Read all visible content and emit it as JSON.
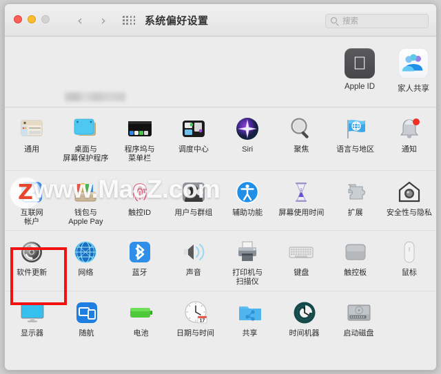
{
  "window": {
    "title": "系统偏好设置",
    "traffic_lights": [
      "close",
      "minimize",
      "zoom"
    ],
    "nav": {
      "back": "‹",
      "forward": "›"
    },
    "grid_icon": "grid-icon"
  },
  "search": {
    "placeholder": "搜索",
    "value": "",
    "icon": "search-icon"
  },
  "account": {
    "name": "",
    "subtitle": "Apple ID、iCloud",
    "avatar": "user-avatar",
    "tiles": [
      {
        "label": "Apple ID",
        "icon": "apple-logo-icon"
      },
      {
        "label": "家人共享",
        "icon": "family-sharing-icon"
      }
    ]
  },
  "watermark": {
    "text": "www.MacZ.com",
    "badge": "Z"
  },
  "highlight": {
    "target": "软件更新",
    "color": "#f21212"
  },
  "panes": {
    "rows": [
      [
        {
          "label": "通用",
          "icon": "general-icon"
        },
        {
          "label": "桌面与\n屏幕保护程序",
          "icon": "desktop-screensaver-icon"
        },
        {
          "label": "程序坞与\n菜单栏",
          "icon": "dock-menubar-icon"
        },
        {
          "label": "调度中心",
          "icon": "mission-control-icon"
        },
        {
          "label": "Siri",
          "icon": "siri-icon"
        },
        {
          "label": "聚焦",
          "icon": "spotlight-icon"
        },
        {
          "label": "语言与地区",
          "icon": "language-region-icon"
        },
        {
          "label": "通知",
          "icon": "notifications-icon"
        }
      ],
      [
        {
          "label": "互联网\n帐户",
          "icon": "internet-accounts-icon"
        },
        {
          "label": "钱包与\nApple Pay",
          "icon": "wallet-applepay-icon"
        },
        {
          "label": "触控ID",
          "icon": "touch-id-icon"
        },
        {
          "label": "用户与群组",
          "icon": "users-groups-icon"
        },
        {
          "label": "辅助功能",
          "icon": "accessibility-icon"
        },
        {
          "label": "屏幕使用时间",
          "icon": "screen-time-icon"
        },
        {
          "label": "扩展",
          "icon": "extensions-icon"
        },
        {
          "label": "安全性与隐私",
          "icon": "security-privacy-icon"
        }
      ],
      [
        {
          "label": "软件更新",
          "icon": "software-update-icon"
        },
        {
          "label": "网络",
          "icon": "network-icon"
        },
        {
          "label": "蓝牙",
          "icon": "bluetooth-icon"
        },
        {
          "label": "声音",
          "icon": "sound-icon"
        },
        {
          "label": "打印机与\n扫描仪",
          "icon": "printers-scanners-icon"
        },
        {
          "label": "键盘",
          "icon": "keyboard-icon"
        },
        {
          "label": "触控板",
          "icon": "trackpad-icon"
        },
        {
          "label": "鼠标",
          "icon": "mouse-icon"
        }
      ],
      [
        {
          "label": "显示器",
          "icon": "displays-icon"
        },
        {
          "label": "随航",
          "icon": "sidecar-icon"
        },
        {
          "label": "电池",
          "icon": "battery-icon"
        },
        {
          "label": "日期与时间",
          "icon": "date-time-icon"
        },
        {
          "label": "共享",
          "icon": "sharing-icon"
        },
        {
          "label": "时间机器",
          "icon": "time-machine-icon"
        },
        {
          "label": "启动磁盘",
          "icon": "startup-disk-icon"
        }
      ]
    ]
  },
  "date_time_icon_day": "17"
}
